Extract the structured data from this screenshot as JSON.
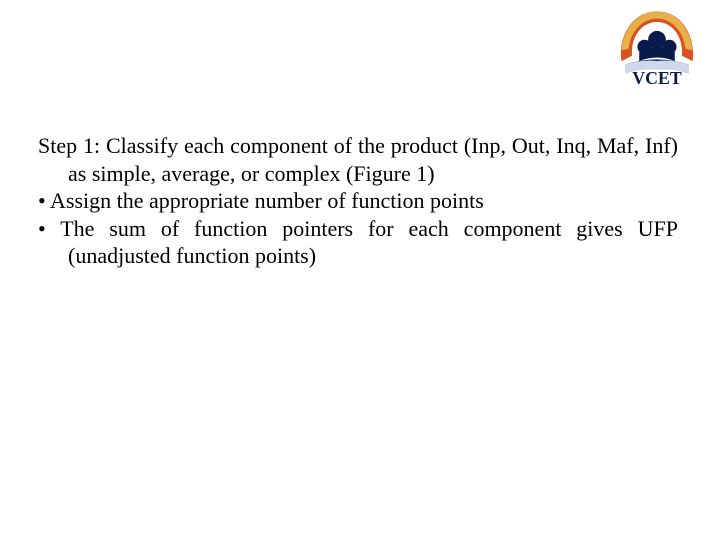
{
  "logo": {
    "label": "VCET"
  },
  "body": {
    "step": "Step 1: Classify each component of the product (Inp, Out, Inq, Maf, Inf) as simple, average, or complex (Figure 1)",
    "bullets": [
      " Assign the appropriate number of function points",
      "The sum of function pointers for each component gives UFP (unadjusted function points)"
    ]
  }
}
